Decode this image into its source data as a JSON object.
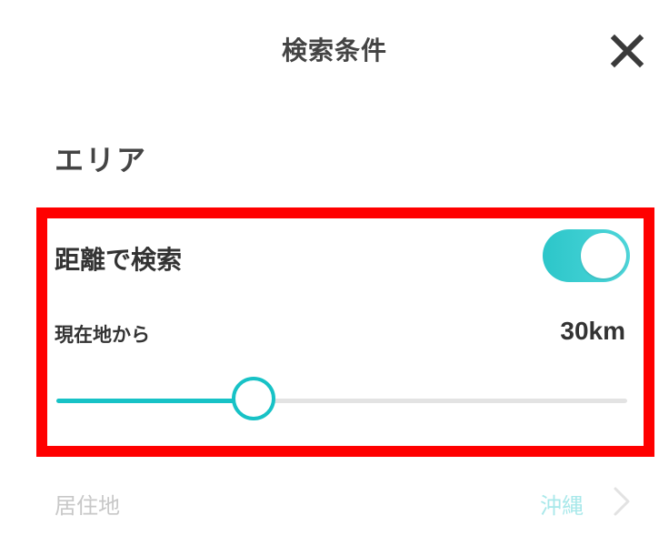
{
  "header": {
    "title": "検索条件",
    "close_icon": "close-icon"
  },
  "area_section": {
    "title": "エリア"
  },
  "distance_search": {
    "label": "距離で検索",
    "toggle_on": true,
    "toggle_color": "#2cc6c9",
    "from_label": "現在地から",
    "value_text": "30km",
    "slider_fraction": 0.345,
    "slider_color": "#17c2c6",
    "highlight_color": "#ff0000"
  },
  "residence": {
    "label": "居住地",
    "value": "沖縄",
    "chevron_icon": "chevron-right-icon"
  }
}
